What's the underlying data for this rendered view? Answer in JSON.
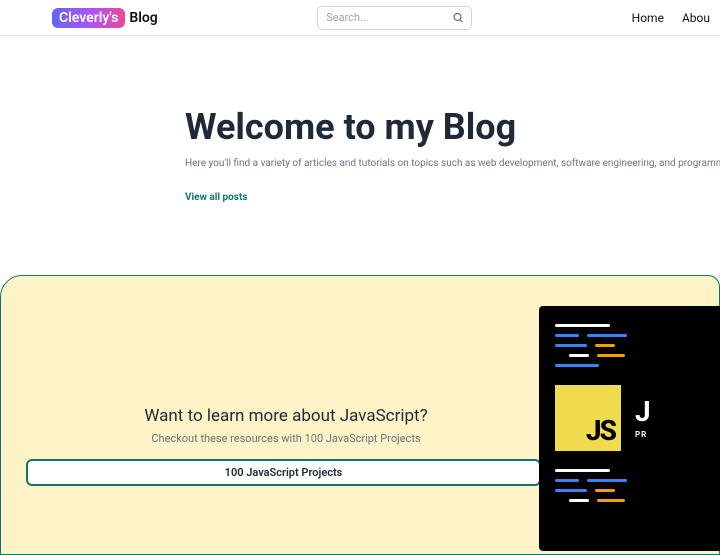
{
  "header": {
    "logo_badge": "Cleverly's",
    "logo_text": "Blog",
    "search_placeholder": "Search...",
    "nav": {
      "home": "Home",
      "about": "Abou"
    }
  },
  "hero": {
    "title": "Welcome to my Blog",
    "subtitle": "Here you'll find a variety of articles and tutorials on topics such as web development, software engineering, and programming languages.",
    "link": "View all posts"
  },
  "promo": {
    "title": "Want to learn more about JavaScript?",
    "subtitle": "Checkout these resources with 100 JavaScript Projects",
    "button": "100 JavaScript Projects",
    "card": {
      "js_label": "JS",
      "side_big": "J",
      "side_small": "PR"
    }
  }
}
